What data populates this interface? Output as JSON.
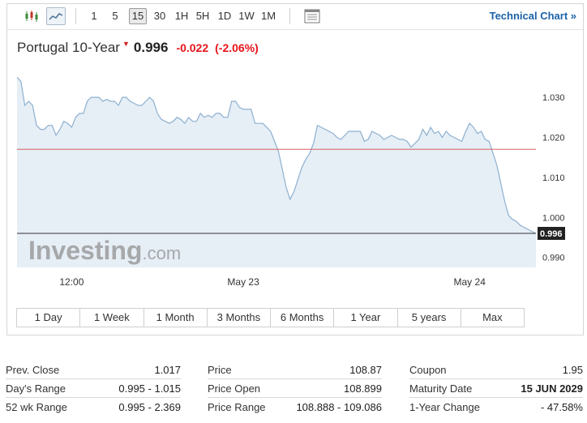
{
  "toolbar": {
    "intervals": [
      "1",
      "5",
      "15",
      "30",
      "1H",
      "5H",
      "1D",
      "1W",
      "1M"
    ],
    "active_interval": "15",
    "technical_chart_link": "Technical Chart »"
  },
  "instrument": {
    "name": "Portugal 10-Year",
    "price": "0.996",
    "change": "-0.022",
    "change_pct": "(-2.06%)",
    "direction_marker": "▼"
  },
  "watermark": {
    "brand": "Investing",
    "suffix": ".com"
  },
  "chart_data": {
    "type": "area",
    "x_labels": [
      "12:00",
      "May 23",
      "May 24"
    ],
    "y_ticks": [
      "1.030",
      "1.020",
      "1.010",
      "1.000",
      "0.990"
    ],
    "ylim": [
      0.9875,
      1.0365
    ],
    "prev_close_line": 1.017,
    "current_value_label": "0.996",
    "grid": false,
    "colors": {
      "line": "#8db0d0",
      "fill": "#e6eef6",
      "prev_close": "#d66060",
      "last": "#333333"
    },
    "values": [
      1.035,
      1.034,
      1.028,
      1.029,
      1.028,
      1.023,
      1.022,
      1.022,
      1.023,
      1.023,
      1.0205,
      1.022,
      1.024,
      1.0235,
      1.0225,
      1.025,
      1.026,
      1.026,
      1.029,
      1.03,
      1.03,
      1.03,
      1.029,
      1.0295,
      1.029,
      1.029,
      1.028,
      1.03,
      1.03,
      1.029,
      1.0285,
      1.028,
      1.028,
      1.029,
      1.03,
      1.029,
      1.026,
      1.0245,
      1.024,
      1.0235,
      1.024,
      1.025,
      1.0245,
      1.0235,
      1.025,
      1.024,
      1.024,
      1.026,
      1.025,
      1.0255,
      1.025,
      1.026,
      1.026,
      1.025,
      1.025,
      1.029,
      1.029,
      1.0275,
      1.027,
      1.027,
      1.027,
      1.0235,
      1.0235,
      1.0235,
      1.0225,
      1.0215,
      1.019,
      1.0165,
      1.012,
      1.0075,
      1.0045,
      1.0065,
      1.0095,
      1.0125,
      1.0145,
      1.016,
      1.0185,
      1.023,
      1.0225,
      1.022,
      1.0215,
      1.021,
      1.02,
      1.0195,
      1.0205,
      1.0215,
      1.0215,
      1.0215,
      1.0215,
      1.019,
      1.0195,
      1.0215,
      1.021,
      1.0205,
      1.0195,
      1.02,
      1.0205,
      1.02,
      1.0195,
      1.0195,
      1.019,
      1.0175,
      1.0185,
      1.0195,
      1.022,
      1.0205,
      1.0225,
      1.021,
      1.0215,
      1.02,
      1.0215,
      1.0205,
      1.02,
      1.0195,
      1.019,
      1.0215,
      1.0235,
      1.0225,
      1.021,
      1.0215,
      1.0195,
      1.019,
      1.016,
      1.013,
      1.0085,
      1.004,
      1.0005,
      0.9995,
      0.999,
      0.998,
      0.9975,
      0.997,
      0.9965,
      0.996
    ]
  },
  "ranges": [
    "1 Day",
    "1 Week",
    "1 Month",
    "3 Months",
    "6 Months",
    "1 Year",
    "5 years",
    "Max"
  ],
  "stats": {
    "col1": [
      {
        "label": "Prev. Close",
        "value": "1.017"
      },
      {
        "label": "Day's Range",
        "value": "0.995 - 1.015"
      },
      {
        "label": "52 wk Range",
        "value": "0.995 - 2.369"
      }
    ],
    "col2": [
      {
        "label": "Price",
        "value": "108.87"
      },
      {
        "label": "Price Open",
        "value": "108.899"
      },
      {
        "label": "Price Range",
        "value": "108.888 - 109.086"
      }
    ],
    "col3": [
      {
        "label": "Coupon",
        "value": "1.95"
      },
      {
        "label": "Maturity Date",
        "value": "15 JUN 2029"
      },
      {
        "label": "1-Year Change",
        "value": "- 47.58%"
      }
    ]
  }
}
